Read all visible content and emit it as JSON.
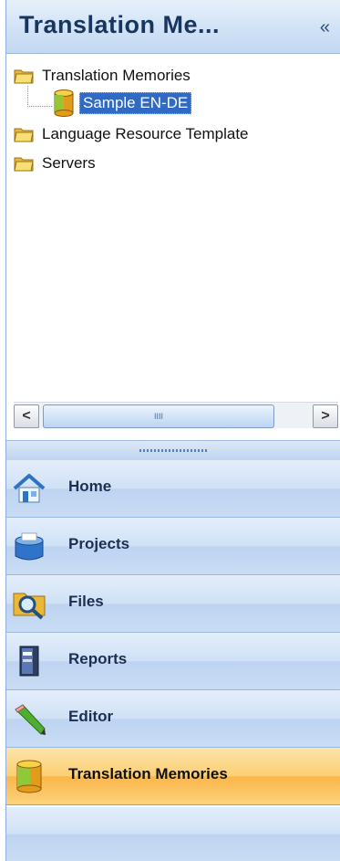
{
  "header": {
    "title": "Translation Me...",
    "collapse_glyph": "«"
  },
  "tree": {
    "root_label": "Translation Memories",
    "child_label": "Sample EN-DE",
    "templates_label": "Language Resource Template",
    "servers_label": "Servers"
  },
  "scrollbar": {
    "left_arrow": "<",
    "right_arrow": ">",
    "thumb_grip": "IIII"
  },
  "nav": {
    "home": "Home",
    "projects": "Projects",
    "files": "Files",
    "reports": "Reports",
    "editor": "Editor",
    "translation_memories": "Translation Memories",
    "active_item": "translation_memories"
  },
  "icons": {
    "folder": "folder-icon",
    "database": "database-icon",
    "home": "home-icon",
    "projects": "projects-icon",
    "files": "files-icon",
    "reports": "reports-icon",
    "editor": "editor-icon"
  },
  "colors": {
    "header_title": "#17355e",
    "selection": "#316ac5",
    "nav_active": "#fbb648",
    "nav_normal": "#d0e1f6"
  }
}
